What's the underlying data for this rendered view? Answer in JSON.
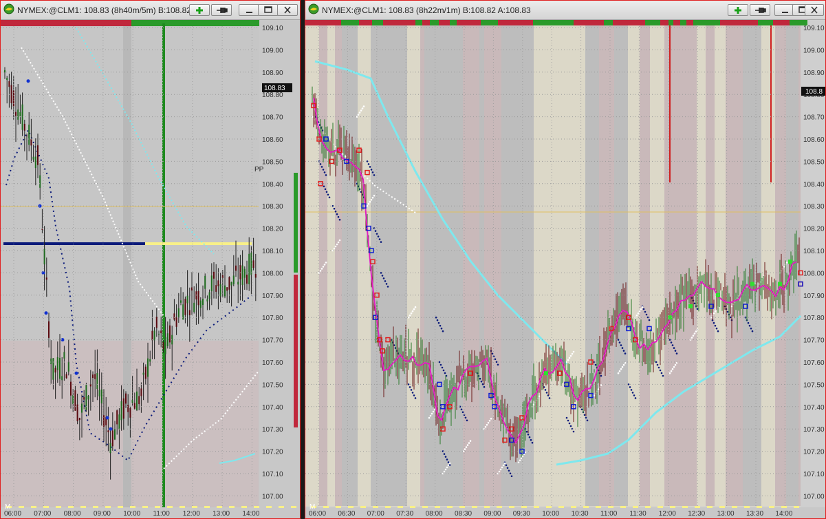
{
  "left": {
    "title": "NYMEX:@CLM1: 108.83 (8h40m/5m)  B:108.82",
    "price_labels": [
      "109.10",
      "109.00",
      "108.90",
      "108.80",
      "108.70",
      "108.60",
      "108.50",
      "108.40",
      "108.30",
      "108.20",
      "108.10",
      "108.00",
      "107.90",
      "107.80",
      "107.70",
      "107.60",
      "107.50",
      "107.40",
      "107.30",
      "107.20",
      "107.10",
      "107.00"
    ],
    "time_labels": [
      "06:00",
      "07:00",
      "08:00",
      "09:00",
      "10:00",
      "11:00",
      "12:00",
      "13:00",
      "14:00"
    ],
    "last_price": "108.83",
    "pivot_label": "PP",
    "corner_label": "M"
  },
  "right": {
    "title": "NYMEX:@CLM1: 108.83 (8h22m/1m)  B:108.82  A:108.83",
    "price_labels": [
      "109.10",
      "109.00",
      "108.90",
      "108.80",
      "108.70",
      "108.60",
      "108.50",
      "108.40",
      "108.30",
      "108.20",
      "108.10",
      "108.00",
      "107.90",
      "107.80",
      "107.70",
      "107.60",
      "107.50",
      "107.40",
      "107.30",
      "107.20",
      "107.10",
      "107.00"
    ],
    "time_labels": [
      "06:00",
      "06:30",
      "07:00",
      "07:30",
      "08:00",
      "08:30",
      "09:00",
      "09:30",
      "10:00",
      "10:30",
      "11:00",
      "11:30",
      "12:00",
      "12:30",
      "13:00",
      "13:30",
      "14:00"
    ],
    "last_price": "108.8",
    "corner_label": "M"
  },
  "colors": {
    "green_marker": "#2a9a2a",
    "red_marker": "#c0283c",
    "cyan_trend": "#7ee8ee",
    "navy_line": "#0a1a7a",
    "yellow_line": "#f8f088",
    "magenta_avg": "#e020c0",
    "pivot_line": "#e0c060"
  },
  "icons": [
    "chart-app-icon",
    "add-symbol-icon",
    "pin-icon",
    "minimize-icon",
    "maximize-icon",
    "close-icon"
  ]
}
